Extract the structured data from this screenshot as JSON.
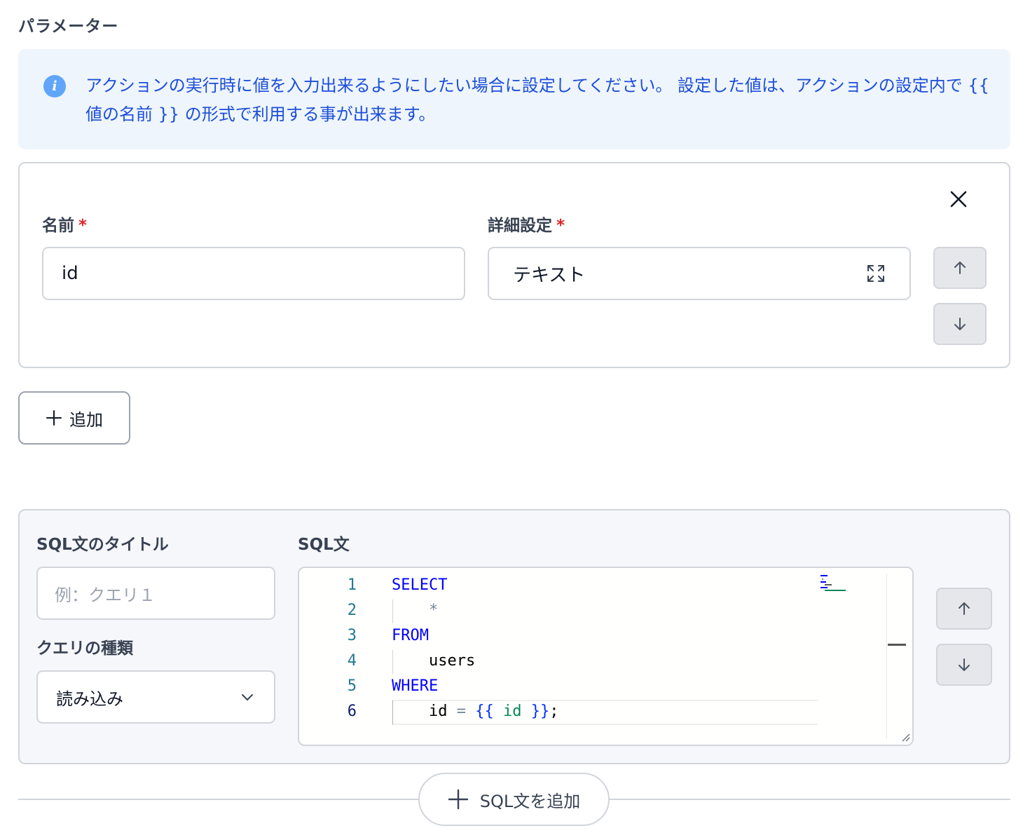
{
  "parameters": {
    "title": "パラメーター",
    "info_text": "アクションの実行時に値を入力出来るようにしたい場合に設定してください。 設定した値は、アクションの設定内で {{ 値の名前 }} の形式で利用する事が出来ます。",
    "name_label": "名前",
    "name_value": "id",
    "detail_label": "詳細設定",
    "detail_value": "テキスト",
    "required_mark": "*",
    "add_label": "追加"
  },
  "sql": {
    "title_label": "SQL文のタイトル",
    "title_placeholder": "例：クエリ１",
    "query_type_label": "クエリの種類",
    "query_type_value": "読み込み",
    "statement_label": "SQL文",
    "line_numbers": [
      "1",
      "2",
      "3",
      "4",
      "5",
      "6"
    ],
    "code_lines": [
      "SELECT",
      "    *",
      "FROM",
      "    users",
      "WHERE",
      "    id = {{ id }};"
    ],
    "add_sql_label": "SQL文を追加"
  },
  "colors": {
    "info_bg": "#eef5fd",
    "info_text": "#1d4ed8",
    "required": "#dc2626",
    "sql_keyword": "#0000ff",
    "template_var": "#098658"
  }
}
